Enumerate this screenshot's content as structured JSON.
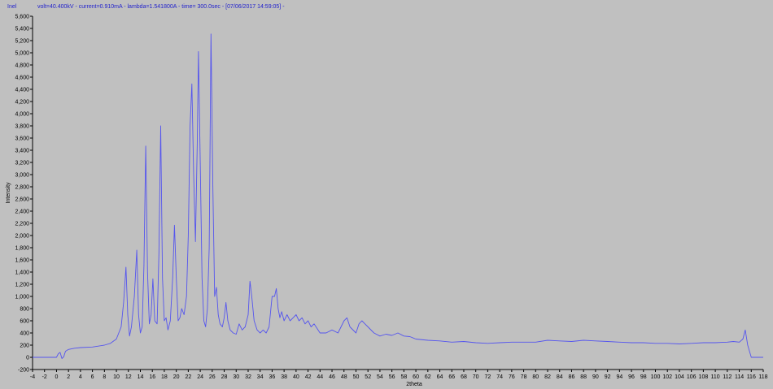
{
  "app": {
    "brand": "Inel"
  },
  "header": {
    "info": "volt=40.400kV - current=0.910mA - lambda=1.541800A - time=  300.0sec - [07/06/2017 14:59:05] -"
  },
  "colors": {
    "background": "#c0c0c0",
    "series": "#5555ee",
    "axis": "#000000"
  },
  "chart_data": {
    "type": "line",
    "title": "",
    "xlabel": "2theta",
    "ylabel": "Intensity",
    "xlim": [
      -4,
      118
    ],
    "ylim": [
      -200,
      5600
    ],
    "grid": false,
    "x_ticks": [
      -4,
      -2,
      0,
      2,
      4,
      6,
      8,
      10,
      12,
      14,
      16,
      18,
      20,
      22,
      24,
      26,
      28,
      30,
      32,
      34,
      36,
      38,
      40,
      42,
      44,
      46,
      48,
      50,
      52,
      54,
      56,
      58,
      60,
      62,
      64,
      66,
      68,
      70,
      72,
      74,
      76,
      78,
      80,
      82,
      84,
      86,
      88,
      90,
      92,
      94,
      96,
      98,
      100,
      102,
      104,
      106,
      108,
      110,
      112,
      114,
      116,
      118
    ],
    "y_ticks": [
      -200,
      0,
      200,
      400,
      600,
      800,
      1000,
      1200,
      1400,
      1600,
      1800,
      2000,
      2200,
      2400,
      2600,
      2800,
      3000,
      3200,
      3400,
      3600,
      3800,
      4000,
      4200,
      4400,
      4600,
      4800,
      5000,
      5200,
      5400,
      5600
    ],
    "series": [
      {
        "x": [
          -4,
          0,
          0.3,
          0.6,
          0.9,
          1.2,
          1.5,
          2,
          3,
          4,
          6,
          8,
          9,
          10,
          10.8,
          11.2,
          11.6,
          11.9,
          12.2,
          12.5,
          13,
          13.4,
          13.7,
          14,
          14.3,
          14.6,
          14.9,
          15.2,
          15.5,
          15.8,
          16.1,
          16.4,
          16.8,
          17.1,
          17.4,
          17.7,
          18,
          18.3,
          18.6,
          19,
          19.4,
          19.7,
          20,
          20.3,
          20.6,
          20.9,
          21.3,
          21.7,
          22,
          22.3,
          22.6,
          22.9,
          23.2,
          23.5,
          23.7,
          24,
          24.3,
          24.6,
          24.9,
          25.2,
          25.5,
          25.8,
          26.1,
          26.4,
          26.7,
          27,
          27.3,
          27.7,
          28,
          28.3,
          28.6,
          29,
          29.5,
          30,
          30.5,
          31,
          31.5,
          32,
          32.3,
          32.6,
          33,
          33.5,
          34,
          34.5,
          35,
          35.5,
          36,
          36.4,
          36.7,
          37,
          37.3,
          37.6,
          38,
          38.5,
          39,
          39.5,
          40,
          40.5,
          41,
          41.5,
          42,
          42.5,
          43,
          44,
          45,
          46,
          47,
          47.5,
          48,
          48.5,
          49,
          50,
          50.5,
          51,
          51.5,
          52,
          53,
          54,
          55,
          56,
          57,
          58,
          59,
          60,
          62,
          64,
          66,
          68,
          70,
          72,
          74,
          76,
          78,
          80,
          82,
          84,
          86,
          88,
          90,
          92,
          94,
          96,
          98,
          100,
          102,
          104,
          106,
          108,
          110,
          112,
          113,
          114,
          114.6,
          115,
          115.4,
          116,
          118
        ],
        "y": [
          0,
          0,
          60,
          80,
          -20,
          10,
          100,
          130,
          150,
          160,
          170,
          200,
          230,
          300,
          500,
          900,
          1480,
          700,
          350,
          500,
          1000,
          1760,
          700,
          400,
          500,
          1500,
          3470,
          1400,
          550,
          700,
          1290,
          600,
          550,
          1700,
          3800,
          1300,
          600,
          650,
          450,
          600,
          1300,
          2170,
          1300,
          600,
          650,
          800,
          700,
          1000,
          2000,
          3800,
          4490,
          3000,
          1900,
          3500,
          5020,
          3200,
          1300,
          600,
          500,
          800,
          1800,
          5310,
          2800,
          1000,
          1150,
          700,
          550,
          500,
          650,
          900,
          600,
          450,
          400,
          380,
          550,
          450,
          500,
          700,
          1250,
          1000,
          600,
          450,
          400,
          450,
          400,
          500,
          1000,
          1000,
          1130,
          800,
          650,
          750,
          600,
          700,
          600,
          650,
          700,
          600,
          650,
          550,
          600,
          500,
          550,
          400,
          400,
          450,
          400,
          500,
          600,
          650,
          500,
          400,
          550,
          600,
          550,
          500,
          400,
          350,
          380,
          360,
          400,
          350,
          340,
          300,
          280,
          270,
          250,
          260,
          240,
          230,
          240,
          250,
          250,
          250,
          280,
          270,
          260,
          280,
          270,
          260,
          250,
          240,
          240,
          230,
          230,
          220,
          230,
          240,
          240,
          250,
          260,
          250,
          300,
          450,
          200,
          0,
          0
        ]
      }
    ]
  }
}
